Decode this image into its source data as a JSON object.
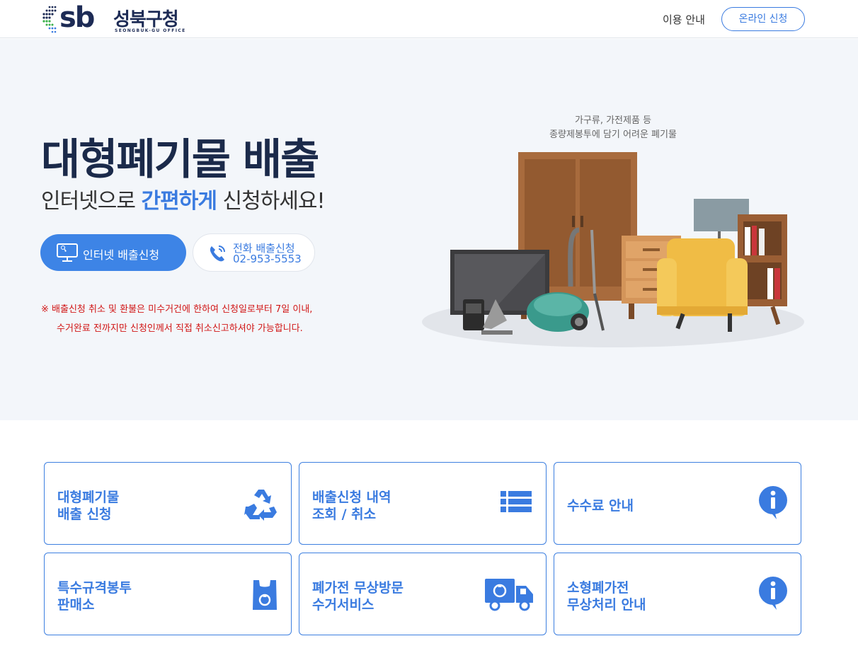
{
  "header": {
    "logo_mark": "sb",
    "logo_name": "성북구청",
    "logo_sub": "SEONGBUK-GU OFFICE",
    "nav_guide": "이용 안내",
    "nav_apply": "온라인 신청"
  },
  "hero": {
    "title": "대형폐기물 배출",
    "subtitle_pre": "인터넷으로 ",
    "subtitle_highlight": "간편하게",
    "subtitle_post": " 신청하세요!",
    "btn_internet": "인터넷 배출신청",
    "btn_phone_line1": "전화 배출신청",
    "btn_phone_line2": "02-953-5553",
    "notice_line1": "※ 배출신청 취소 및 환불은 미수거건에 한하여 신청일로부터 7일 이내,",
    "notice_line2": "수거완료 전까지만 신청인께서 직접 취소신고하셔야 가능합니다.",
    "caption_line1": "가구류, 가전제품 등",
    "caption_line2": "종량제봉투에 담기 어려운 폐기물"
  },
  "cards": [
    {
      "line1": "대형폐기물",
      "line2": "배출 신청",
      "icon": "recycle-icon"
    },
    {
      "line1": "배출신청 내역",
      "line2": "조회 / 취소",
      "icon": "list-icon"
    },
    {
      "line1": "수수료 안내",
      "line2": "",
      "icon": "info-icon"
    },
    {
      "line1": "특수규격봉투",
      "line2": "판매소",
      "icon": "recycle-bag-icon"
    },
    {
      "line1": "폐가전 무상방문",
      "line2": "수거서비스",
      "icon": "truck-icon"
    },
    {
      "line1": "소형폐가전",
      "line2": "무상처리 안내",
      "icon": "info-icon"
    }
  ],
  "colors": {
    "accent": "#3a7be0",
    "title": "#1b2a4a",
    "notice": "#d11616",
    "hero_bg": "#f3f6fa"
  }
}
